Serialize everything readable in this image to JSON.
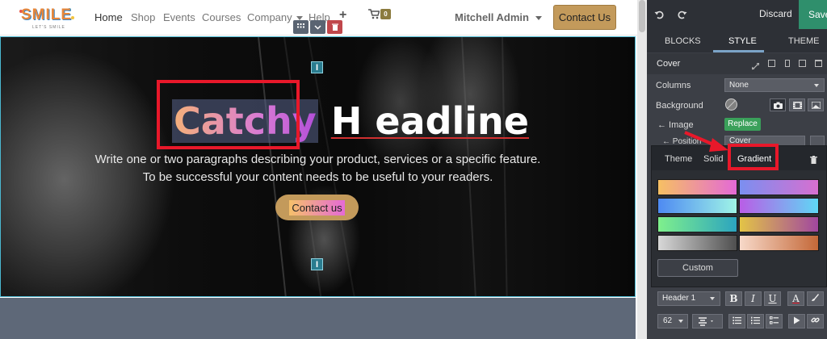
{
  "site": {
    "logo": {
      "word": "SMILE",
      "tagline": "LET'S SMILE"
    },
    "nav": [
      {
        "label": "Home",
        "active": true
      },
      {
        "label": "Shop"
      },
      {
        "label": "Events"
      },
      {
        "label": "Courses"
      },
      {
        "label": "Company"
      },
      {
        "label": "Help"
      }
    ],
    "cart_count": "0",
    "user_name": "Mitchell Admin",
    "contact_button": "Contact Us"
  },
  "cover": {
    "headline_selected": "Catchy",
    "headline_rest": "H eadline",
    "paragraph_line1": "Write one or two paragraphs describing your product, services or a specific feature.",
    "paragraph_line2": "To be successful your content needs to be useful to your readers.",
    "button_label": "Contact us"
  },
  "editor": {
    "discard_label": "Discard",
    "save_label": "Save",
    "tabs": [
      "BLOCKS",
      "STYLE",
      "THEME"
    ],
    "active_tab": "STYLE",
    "section_title": "Cover",
    "options": {
      "columns_label": "Columns",
      "columns_value": "None",
      "background_label": "Background",
      "image_label": "← Image",
      "replace_label": "Replace",
      "position_label": "← Position",
      "position_value": "Cover"
    },
    "color_picker": {
      "tabs": [
        "Theme",
        "Solid",
        "Gradient"
      ],
      "active_tab": "Gradient",
      "gradients": [
        {
          "from": "#f6c063",
          "to": "#e469d6"
        },
        {
          "from": "#7b8ff0",
          "to": "#d76fd0"
        },
        {
          "from": "#4e8af2",
          "to": "#9ff4e6"
        },
        {
          "from": "#b95de6",
          "to": "#5fd7f5"
        },
        {
          "from": "#7ff08c",
          "to": "#2ca4bf"
        },
        {
          "from": "#e3c446",
          "to": "#a1479f"
        },
        {
          "from": "#d8d8d8",
          "to": "#4f4f4f"
        },
        {
          "from": "#f7d9c9",
          "to": "#c46838"
        }
      ],
      "custom_label": "Custom"
    },
    "text_tools": {
      "heading_value": "Header 1",
      "bold": "B",
      "italic": "I",
      "underline": "U",
      "font_color": "A",
      "size_value": "62"
    }
  },
  "colors": {
    "accent_gold": "#c39a5b",
    "highlight_red": "#e8182a",
    "panel_dark": "#3c3f46",
    "save_green": "#2f8f6c",
    "replace_green": "#3aa05a"
  }
}
